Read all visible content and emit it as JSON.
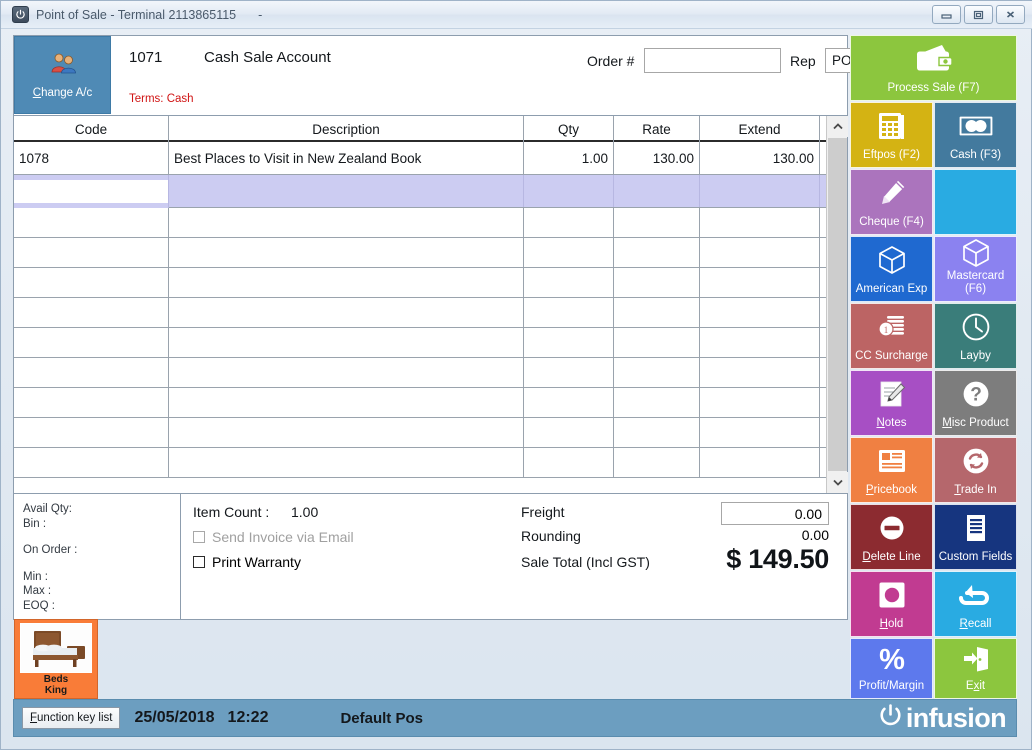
{
  "window": {
    "title": "Point of Sale - Terminal 2113865115",
    "subtitle": "-",
    "icon": "power-icon",
    "controls": {
      "minimize": "minimize-icon",
      "restore": "restore-icon",
      "close": "close-icon"
    }
  },
  "account": {
    "change_button_label": "Change A/c",
    "change_button_accel": "C",
    "code": "1071",
    "name": "Cash Sale Account",
    "terms": "Terms: Cash",
    "order_label": "Order #",
    "order_value": "",
    "order_placeholder": "",
    "rep_label": "Rep",
    "rep_value": "POS",
    "rep_options": [
      "POS"
    ]
  },
  "grid": {
    "columns": [
      "Code",
      "Description",
      "Qty",
      "Rate",
      "Extend"
    ],
    "rows": [
      {
        "code": "1078",
        "description": "Best Places to Visit in New Zealand Book",
        "qty": "1.00",
        "rate": "130.00",
        "extend": "130.00",
        "selected": false
      }
    ],
    "selected_row_index": 1,
    "empty_row_count": 9,
    "scrollbar": {
      "up_icon": "chevron-up-icon",
      "down_icon": "chevron-down-icon"
    }
  },
  "stock_info": {
    "avail_qty": "Avail Qty:",
    "bin": "Bin :",
    "on_order": "On Order :",
    "min": "Min :",
    "max": "Max :",
    "eoq": "EOQ :"
  },
  "totals": {
    "item_count_label": "Item Count :",
    "item_count_value": "1.00",
    "send_invoice_label": "Send Invoice via Email",
    "send_invoice_checked": false,
    "send_invoice_disabled": true,
    "print_warranty_label": "Print Warranty",
    "print_warranty_checked": false,
    "freight_label": "Freight",
    "freight_value": "0.00",
    "rounding_label": "Rounding",
    "rounding_value": "0.00",
    "sale_total_label": "Sale Total (Incl GST)",
    "sale_total_value": "$ 149.50"
  },
  "product_tile": {
    "line1": "Beds",
    "line2": "King",
    "icon": "bed-image",
    "color": "#f97c38"
  },
  "sidebar": {
    "tiles": [
      {
        "label": "Process Sale (F7)",
        "icon": "wallet-icon",
        "color": "#8cc63e",
        "accel": ""
      },
      {
        "label": "Eftpos (F2)",
        "icon": "eftpos-terminal-icon",
        "color": "#d4b313",
        "accel": ""
      },
      {
        "label": "Cash (F3)",
        "icon": "banknote-icon",
        "color": "#437a9e",
        "accel": ""
      },
      {
        "label": "Cheque (F4)",
        "icon": "pen-icon",
        "color": "#ab74bd",
        "accel": ""
      },
      {
        "label": "",
        "icon": "",
        "color": "#29abe2",
        "accel": ""
      },
      {
        "label": "American Exp",
        "icon": "cube-icon",
        "color": "#1f69d0",
        "accel": ""
      },
      {
        "label": "Mastercard (F6)",
        "icon": "cube-icon",
        "color": "#8b82f0",
        "accel": ""
      },
      {
        "label": "CC Surcharge",
        "icon": "coins-icon",
        "color": "#bc6464",
        "accel": ""
      },
      {
        "label": "Layby",
        "icon": "clock-icon",
        "color": "#3a7d7a",
        "accel": ""
      },
      {
        "label": "Notes",
        "icon": "notepad-pencil-icon",
        "color": "#a74fc4",
        "accel": "N"
      },
      {
        "label": "Misc Product",
        "icon": "question-icon",
        "color": "#7d7d7d",
        "accel": "M"
      },
      {
        "label": "Pricebook",
        "icon": "book-icon",
        "color": "#f08042",
        "accel": "P"
      },
      {
        "label": "Trade In",
        "icon": "refresh-icon",
        "color": "#b5676c",
        "accel": "T"
      },
      {
        "label": "Delete Line",
        "icon": "minus-circle-icon",
        "color": "#8c2b30",
        "accel": "D"
      },
      {
        "label": "Custom Fields",
        "icon": "document-lines-icon",
        "color": "#16357f",
        "accel": ""
      },
      {
        "label": "Hold",
        "icon": "record-icon",
        "color": "#c13b91",
        "accel": "H"
      },
      {
        "label": "Recall",
        "icon": "recall-arrow-icon",
        "color": "#29abe2",
        "accel": "R"
      },
      {
        "label": "Profit/Margin",
        "icon": "percent-icon",
        "color": "#5d79ed",
        "accel": ""
      },
      {
        "label": "Exit",
        "icon": "exit-door-icon",
        "color": "#8cc63e",
        "accel": "x"
      }
    ]
  },
  "statusbar": {
    "function_key_label": "Function key list",
    "function_key_accel": "F",
    "date": "25/05/2018",
    "time": "12:22",
    "pos_name": "Default Pos",
    "brand": "infusion",
    "brand_icon": "power-icon"
  }
}
